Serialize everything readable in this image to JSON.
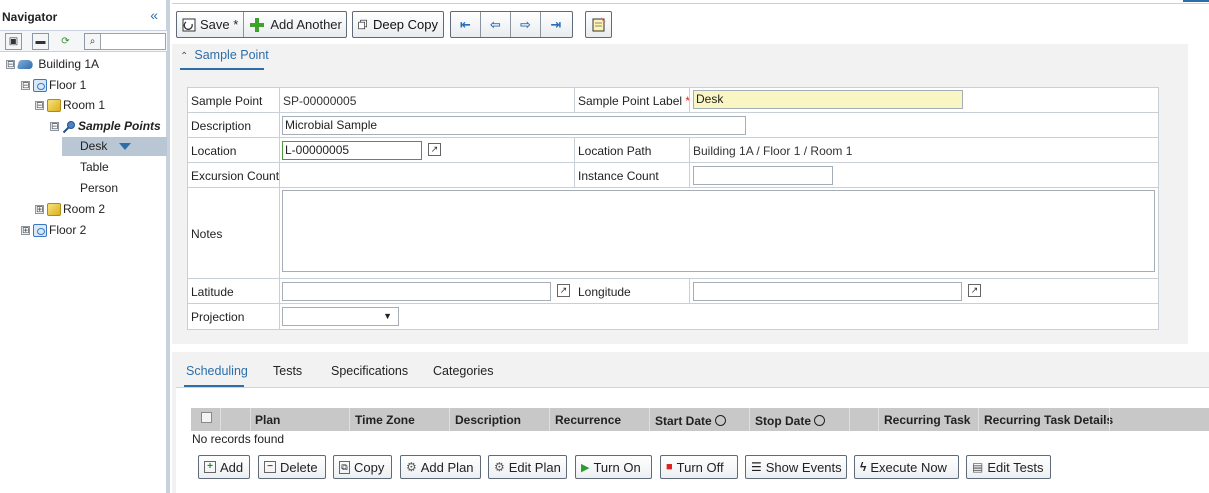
{
  "navigator": {
    "title": "Navigator",
    "collapse_glyph": "«",
    "tree": [
      {
        "label": "Building 1A",
        "expander": "⊟",
        "icon": "building-icon"
      },
      {
        "label": "Floor 1",
        "expander": "⊟",
        "icon": "floor-icon"
      },
      {
        "label": "Room 1",
        "expander": "⊟",
        "icon": "room-icon"
      },
      {
        "label": "Sample Points",
        "expander": "⊟",
        "icon": "sample-points-icon"
      },
      {
        "label": "Desk",
        "selected": true
      },
      {
        "label": "Table"
      },
      {
        "label": "Person"
      },
      {
        "label": "Room 2",
        "expander": "⊞",
        "icon": "room-icon"
      },
      {
        "label": "Floor 2",
        "expander": "⊞",
        "icon": "floor-icon"
      }
    ]
  },
  "toolbar": {
    "save_label": "Save *",
    "add_another_label": "Add Another",
    "deep_copy_label": "Deep Copy"
  },
  "section": {
    "title": "Sample Point"
  },
  "form": {
    "sample_point_label": "Sample Point",
    "sample_point_value": "SP-00000005",
    "sample_point_label_label": "Sample Point Label",
    "sample_point_label_value": "Desk",
    "required_mark": "*",
    "description_label": "Description",
    "description_value": "Microbial Sample",
    "location_label": "Location",
    "location_value": "L-00000005",
    "location_path_label": "Location Path",
    "location_path_value": "Building 1A / Floor 1 / Room 1",
    "excursion_count_label": "Excursion Count",
    "instance_count_label": "Instance Count",
    "instance_count_value": "",
    "notes_label": "Notes",
    "notes_value": "",
    "latitude_label": "Latitude",
    "latitude_value": "",
    "longitude_label": "Longitude",
    "longitude_value": "",
    "projection_label": "Projection",
    "projection_value": ""
  },
  "tabs": [
    {
      "label": "Scheduling",
      "active": true
    },
    {
      "label": "Tests"
    },
    {
      "label": "Specifications"
    },
    {
      "label": "Categories"
    }
  ],
  "grid": {
    "columns": [
      "Plan",
      "Time Zone",
      "Description",
      "Recurrence",
      "Start Date",
      "Stop Date",
      "Recurring Task",
      "Recurring Task Details"
    ],
    "empty_message": "No records found"
  },
  "actions": {
    "add": "Add",
    "delete": "Delete",
    "copy": "Copy",
    "add_plan": "Add Plan",
    "edit_plan": "Edit Plan",
    "turn_on": "Turn On",
    "turn_off": "Turn Off",
    "show_events": "Show Events",
    "execute_now": "Execute Now",
    "edit_tests": "Edit Tests"
  },
  "colors": {
    "accent": "#2d6ea8",
    "required_field_bg": "#faf6c4",
    "selected_tree_row": "#b9c6d3",
    "grid_header_bg": "#c8c8c8"
  }
}
